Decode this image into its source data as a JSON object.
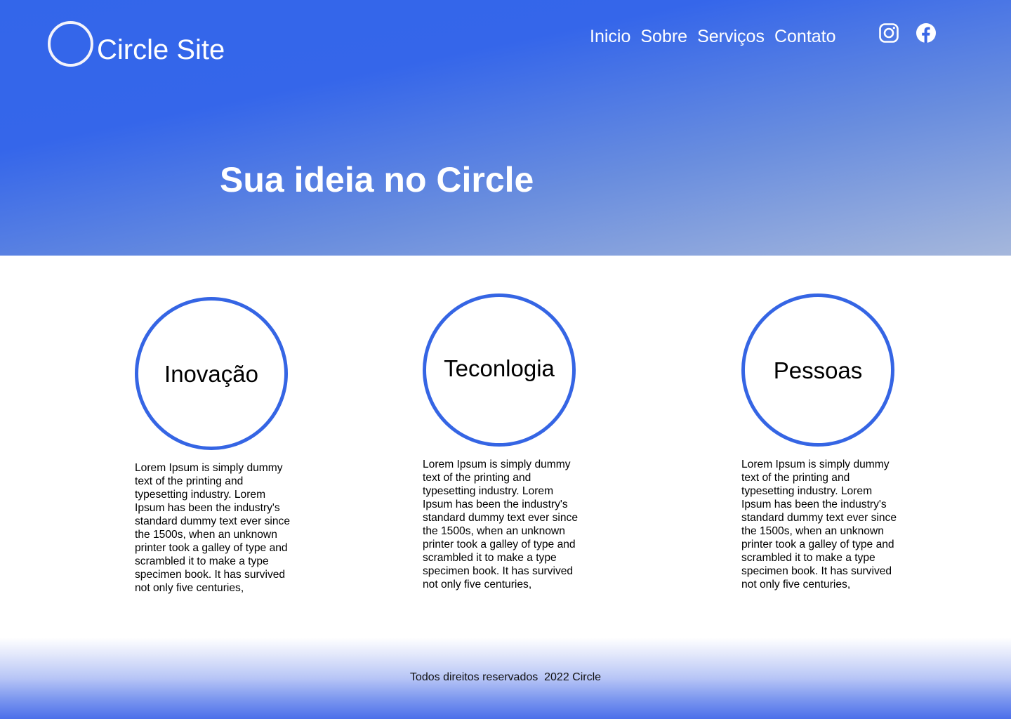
{
  "brand": {
    "name": "Circle Site"
  },
  "nav": {
    "items": [
      "Inicio",
      "Sobre",
      "Serviços",
      "Contato"
    ]
  },
  "social": {
    "instagram_icon": "instagram-icon",
    "facebook_icon": "facebook-icon"
  },
  "hero": {
    "title": "Sua ideia no Circle"
  },
  "features": [
    {
      "title": "Inovação",
      "text": "Lorem Ipsum is simply dummy text of the printing and typesetting industry. Lorem Ipsum has been the industry's standard dummy text ever since the 1500s, when an unknown printer took a galley of type and scrambled it to make a type specimen book. It has survived not only five centuries,"
    },
    {
      "title": "Teconlogia",
      "text": "Lorem Ipsum is simply dummy text of the printing and typesetting industry. Lorem Ipsum has been the industry's standard dummy text ever since the 1500s, when an unknown printer took a galley of type and scrambled it to make a type specimen book. It has survived not only five centuries,"
    },
    {
      "title": "Pessoas",
      "text": "Lorem Ipsum is simply dummy text of the printing and typesetting industry. Lorem Ipsum has been the industry's standard dummy text ever since the 1500s, when an unknown printer took a galley of type and scrambled it to make a type specimen book. It has survived not only five centuries,"
    }
  ],
  "footer": {
    "text": "Todos direitos reservados  2022 Circle"
  },
  "colors": {
    "accent": "#3366ea",
    "circle_border": "#3565e4",
    "text": "#000000"
  }
}
